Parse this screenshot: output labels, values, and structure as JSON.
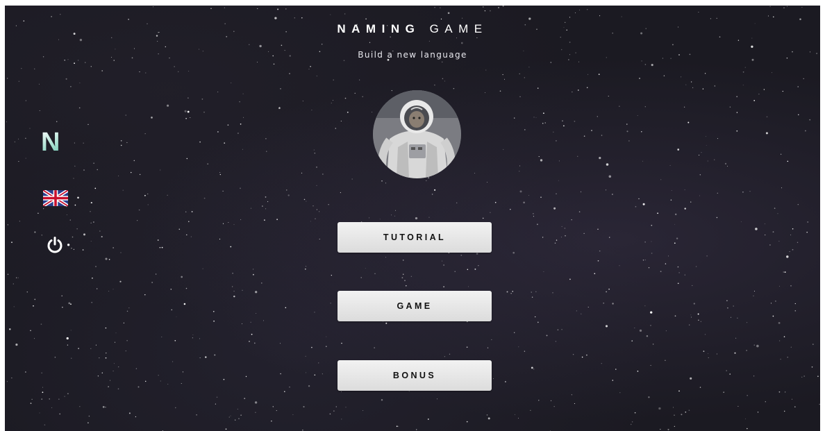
{
  "header": {
    "title_bold": "NAMING",
    "title_light": "GAME",
    "subtitle": "Build a new language"
  },
  "sidebar": {
    "logo_letter": "N",
    "language_flag": "uk-flag-icon",
    "power_icon": "power-icon"
  },
  "avatar": {
    "icon": "astronaut-avatar"
  },
  "menu": {
    "tutorial_label": "TUTORIAL",
    "game_label": "GAME",
    "bonus_label": "BONUS"
  },
  "colors": {
    "background": "#1b1a22",
    "button_face": "#e6e6e6",
    "button_text": "#111111",
    "logo_accent": "#6ec9b3"
  }
}
